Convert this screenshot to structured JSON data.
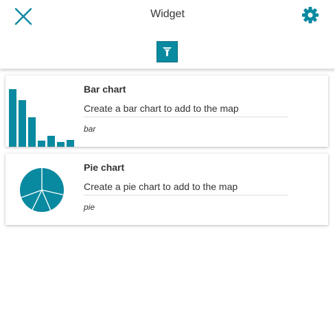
{
  "header": {
    "title": "Widget"
  },
  "widgets": [
    {
      "title": "Bar chart",
      "description": "Create a bar chart to add to the map",
      "tag": "bar",
      "thumbnail": "bar-chart-icon"
    },
    {
      "title": "Pie chart",
      "description": "Create a pie chart to add to the map",
      "tag": "pie",
      "thumbnail": "pie-chart-icon"
    }
  ],
  "icons": {
    "close": "close-icon",
    "settings": "gear-icon",
    "filter": "filter-icon"
  },
  "colors": {
    "accent": "#0a8aa0",
    "text": "#333333"
  }
}
